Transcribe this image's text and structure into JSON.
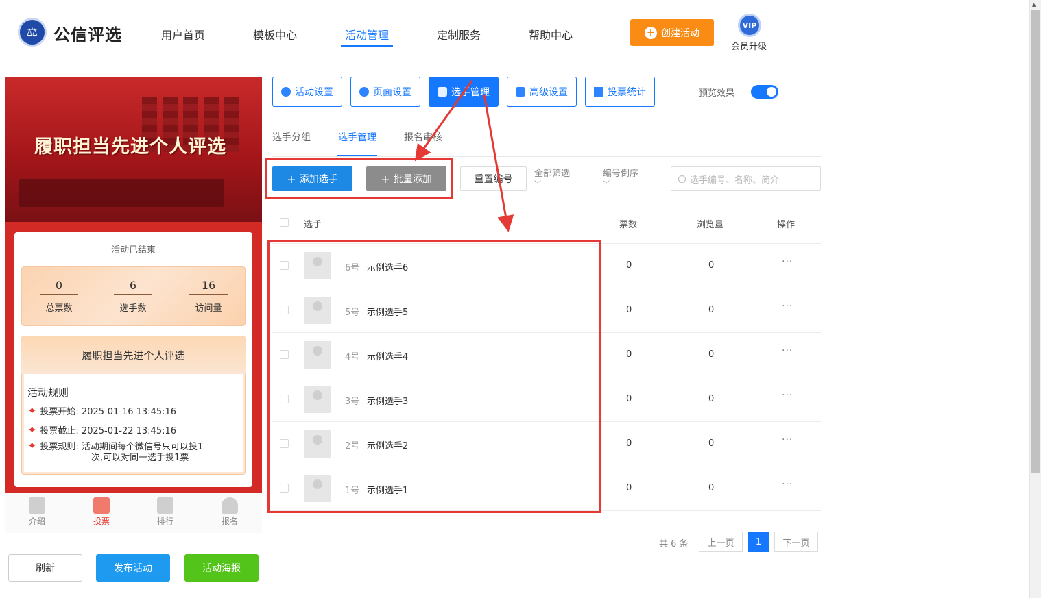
{
  "header": {
    "brand": "公信评选",
    "nav": [
      "用户首页",
      "模板中心",
      "活动管理",
      "定制服务",
      "帮助中心"
    ],
    "active_nav": "活动管理",
    "create_button": "创建活动",
    "vip_badge": "VIP",
    "vip_label": "会员升级"
  },
  "preview": {
    "banner_title": "履职担当先进个人评选",
    "status": "活动已结束",
    "stats": [
      {
        "value": "0",
        "label": "总票数"
      },
      {
        "value": "6",
        "label": "选手数"
      },
      {
        "value": "16",
        "label": "访问量"
      }
    ],
    "rules_heading": "履职担当先进个人评选",
    "rules_title": "活动规则",
    "rules": [
      {
        "key": "投票开始:",
        "value": "2025-01-16 13:45:16"
      },
      {
        "key": "投票截止:",
        "value": "2025-01-22 13:45:16"
      },
      {
        "key": "投票规则:",
        "value": "活动期间每个微信号只可以投1",
        "value2": "次,可以对同一选手投1票"
      }
    ],
    "bottom_nav": [
      {
        "label": "介绍",
        "icon": "document-icon"
      },
      {
        "label": "投票",
        "icon": "home-icon"
      },
      {
        "label": "排行",
        "icon": "crown-icon"
      },
      {
        "label": "报名",
        "icon": "user-icon"
      }
    ],
    "active_bottom_nav": "投票"
  },
  "bottom_buttons": {
    "refresh": "刷新",
    "publish": "发布活动",
    "poster": "活动海报"
  },
  "setting_tabs": [
    "活动设置",
    "页面设置",
    "选手管理",
    "高级设置",
    "投票统计"
  ],
  "active_setting_tab": "选手管理",
  "preview_toggle": {
    "label": "预览效果",
    "on": true
  },
  "sub_tabs": [
    "选手分组",
    "选手管理",
    "报名审核"
  ],
  "active_sub_tab": "选手管理",
  "toolbar": {
    "add": "添加选手",
    "batch": "批量添加",
    "reset": "重置编号",
    "filter": "全部筛选",
    "sort": "编号倒序",
    "search_placeholder": "选手编号、名称、简介"
  },
  "table": {
    "headers": {
      "player": "选手",
      "votes": "票数",
      "views": "浏览量",
      "actions": "操作"
    },
    "rows": [
      {
        "num": "6号",
        "name": "示例选手6",
        "votes": "0",
        "views": "0"
      },
      {
        "num": "5号",
        "name": "示例选手5",
        "votes": "0",
        "views": "0"
      },
      {
        "num": "4号",
        "name": "示例选手4",
        "votes": "0",
        "views": "0"
      },
      {
        "num": "3号",
        "name": "示例选手3",
        "votes": "0",
        "views": "0"
      },
      {
        "num": "2号",
        "name": "示例选手2",
        "votes": "0",
        "views": "0"
      },
      {
        "num": "1号",
        "name": "示例选手1",
        "votes": "0",
        "views": "0"
      }
    ],
    "more_symbol": "···"
  },
  "pagination": {
    "total": "共 6 条",
    "prev": "上一页",
    "current": "1",
    "next": "下一页"
  },
  "colors": {
    "primary": "#1677ff",
    "accent_orange": "#fa8c16",
    "annotation_red": "#e53935",
    "banner_red": "#c92a2a"
  }
}
